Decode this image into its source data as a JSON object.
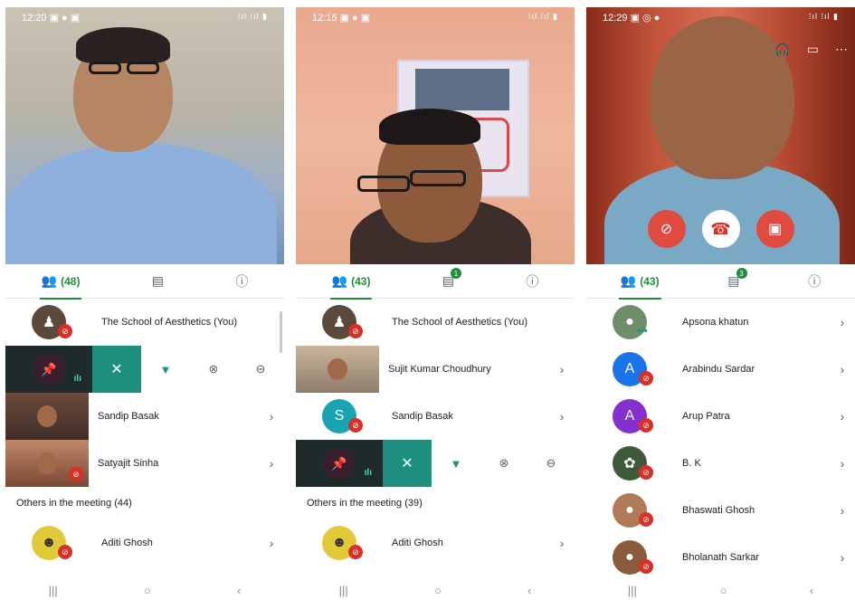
{
  "phones": [
    {
      "status": {
        "time": "12:20",
        "icons": "▣ ● ▣",
        "signal": "⁞ıl ⁞ıl ▮"
      },
      "tabs": {
        "people": "(48)",
        "chat_badge": "",
        "info": "ⓘ"
      },
      "rows": [
        {
          "name": "The School of Aesthetics (You)"
        },
        {
          "name": "Sandip Basak"
        },
        {
          "name": "Satyajit Sinha"
        }
      ],
      "section_label": "Others in the meeting (44)",
      "others": [
        {
          "name": "Aditi Ghosh"
        }
      ]
    },
    {
      "status": {
        "time": "12:16",
        "icons": "▣ ● ▣",
        "signal": "⁞ıl ⁞ıl ▮"
      },
      "tabs": {
        "people": "(43)",
        "chat_badge": "1",
        "info": "ⓘ"
      },
      "rows": [
        {
          "name": "The School of Aesthetics (You)"
        },
        {
          "name": "Sujit Kumar Choudhury"
        },
        {
          "name": "Sandip Basak",
          "initial": "S"
        }
      ],
      "section_label": "Others in the meeting (39)",
      "others": [
        {
          "name": "Aditi Ghosh"
        }
      ]
    },
    {
      "status": {
        "time": "12:29",
        "icons": "▣ ◎ ●",
        "signal": "⁞ıl ⁞ıl ▮"
      },
      "tabs": {
        "people": "(43)",
        "chat_badge": "3",
        "info": "ⓘ"
      },
      "rows": [
        {
          "name": "Apsona khatun"
        },
        {
          "name": "Arabindu Sardar",
          "initial": "A"
        },
        {
          "name": "Arup Patra",
          "initial": "A"
        },
        {
          "name": "B. K"
        },
        {
          "name": "Bhaswati Ghosh"
        },
        {
          "name": "Bholanath Sarkar"
        }
      ]
    }
  ],
  "icons": {
    "people": "people-icon",
    "chat": "chat-icon",
    "info": "info-icon",
    "mic_off": "mic-off-icon",
    "chevron": "chevron-right-icon",
    "pin": "pin-icon",
    "close": "close-icon",
    "mute_all": "mute-icon",
    "remove": "remove-icon",
    "hangup": "hangup-icon",
    "cam_off": "camera-off-icon",
    "headphones": "headphones-icon",
    "captions": "captions-icon",
    "more": "more-icon"
  },
  "colors": {
    "accent": "#1e8e3e",
    "teal": "#1e8e7e",
    "mute": "#d93025"
  }
}
